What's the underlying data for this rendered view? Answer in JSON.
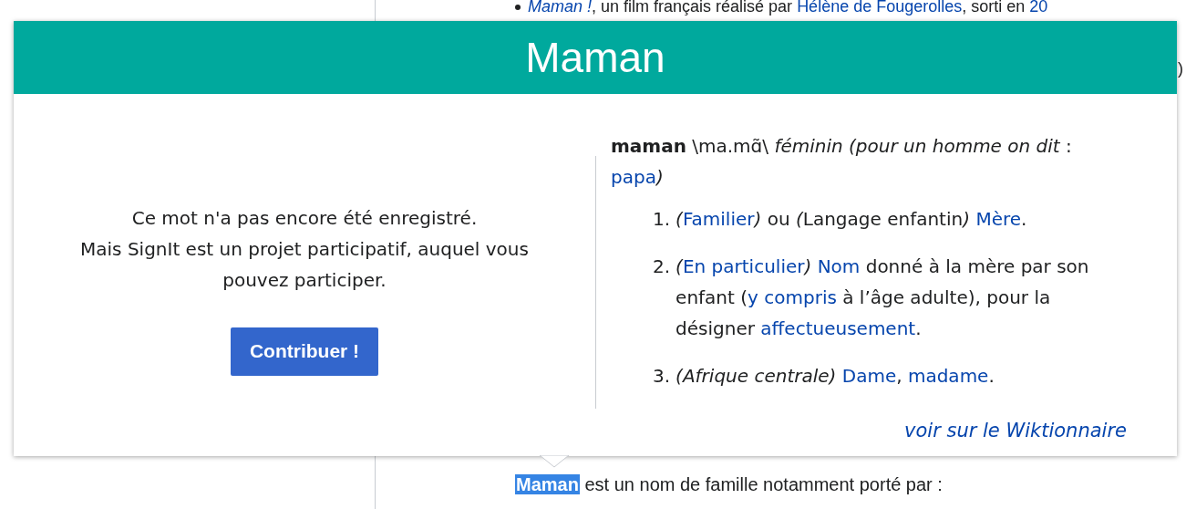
{
  "page": {
    "top_line": [
      {
        "kind": "italic-link",
        "text": "Maman !"
      },
      {
        "kind": "plain",
        "text": ", un film français réalisé par "
      },
      {
        "kind": "link",
        "text": "Hélène de Fougerolles"
      },
      {
        "kind": "plain",
        "text": ", sorti en "
      },
      {
        "kind": "link",
        "text": "20"
      }
    ],
    "edge_fragment": ")",
    "bottom_line": {
      "highlighted": "Maman",
      "rest": " est un nom de famille notamment porté par :"
    }
  },
  "popup": {
    "title": "Maman",
    "message": [
      "Ce mot n'a pas encore été enregistré.",
      "Mais SignIt est un projet participatif, auquel vous pouvez participer."
    ],
    "button": "Contribuer !",
    "headword": [
      {
        "kind": "bold",
        "text": "maman"
      },
      {
        "kind": "plain",
        "text": " \\ma.mɑ̃\\ "
      },
      {
        "kind": "italic",
        "text": "féminin (pour un homme on dit"
      },
      {
        "kind": "plain",
        "text": " : "
      },
      {
        "kind": "link",
        "text": "papa"
      },
      {
        "kind": "italic",
        "text": ")"
      }
    ],
    "definitions": [
      {
        "number": "1.",
        "segments": [
          {
            "kind": "italic",
            "text": "("
          },
          {
            "kind": "link",
            "text": "Familier"
          },
          {
            "kind": "italic",
            "text": ")"
          },
          {
            "kind": "plain",
            "text": " ou "
          },
          {
            "kind": "italic",
            "text": "("
          },
          {
            "kind": "plain",
            "text": "Langage enfantin"
          },
          {
            "kind": "italic",
            "text": ")"
          },
          {
            "kind": "space"
          },
          {
            "kind": "link",
            "text": "Mère"
          },
          {
            "kind": "plain",
            "text": "."
          }
        ]
      },
      {
        "number": "2.",
        "segments": [
          {
            "kind": "italic",
            "text": "("
          },
          {
            "kind": "link",
            "text": "En particulier"
          },
          {
            "kind": "italic",
            "text": ")"
          },
          {
            "kind": "space"
          },
          {
            "kind": "link",
            "text": "Nom"
          },
          {
            "kind": "plain",
            "text": " donné à la mère par son enfant ("
          },
          {
            "kind": "link",
            "text": "y compris"
          },
          {
            "kind": "plain",
            "text": " à l’âge adulte), pour la désigner "
          },
          {
            "kind": "link",
            "text": "affectueusement"
          },
          {
            "kind": "plain",
            "text": "."
          }
        ]
      },
      {
        "number": "3.",
        "segments": [
          {
            "kind": "italic",
            "text": "(Afrique centrale)"
          },
          {
            "kind": "space"
          },
          {
            "kind": "link",
            "text": "Dame"
          },
          {
            "kind": "plain",
            "text": ", "
          },
          {
            "kind": "link",
            "text": "madame"
          },
          {
            "kind": "plain",
            "text": "."
          }
        ]
      }
    ],
    "source_link": "voir sur le Wiktionnaire"
  }
}
